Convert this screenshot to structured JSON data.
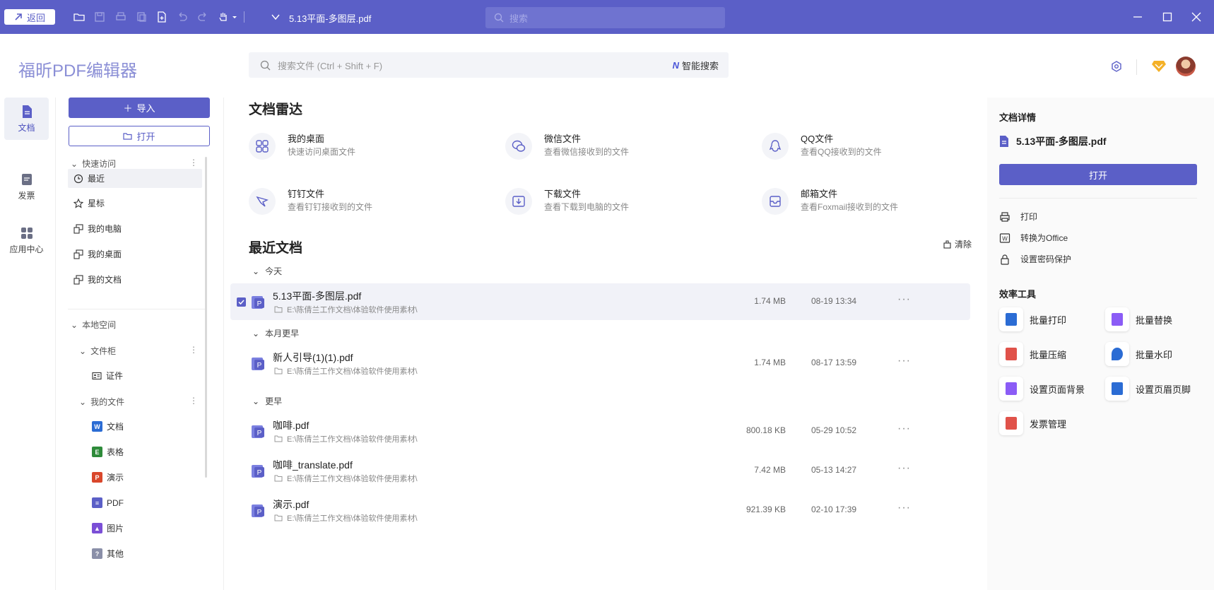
{
  "titlebar": {
    "back_label": "返回",
    "doc_title": "5.13平面-多图层.pdf",
    "search_placeholder": "搜索",
    "icons": [
      "open-folder-icon",
      "save-icon",
      "print-icon",
      "copy-icon",
      "new-file-icon",
      "undo-icon",
      "redo-icon",
      "hand-tool-icon",
      "dropdown-icon"
    ]
  },
  "header": {
    "app_title": "福昕PDF编辑器",
    "search_placeholder": "搜索文件 (Ctrl + Shift + F)",
    "ai_search_label": "智能搜索"
  },
  "leftbar": {
    "items": [
      {
        "label": "文档",
        "icon": "document-icon",
        "active": true
      },
      {
        "label": "发票",
        "icon": "invoice-icon",
        "active": false
      },
      {
        "label": "应用中心",
        "icon": "apps-icon",
        "active": false
      }
    ]
  },
  "nav": {
    "import_label": "导入",
    "open_label": "打开",
    "quick_access": {
      "label": "快速访问",
      "items": [
        {
          "label": "最近",
          "icon": "clock-icon"
        },
        {
          "label": "星标",
          "icon": "star-icon"
        },
        {
          "label": "我的电脑",
          "icon": "computer-icon"
        },
        {
          "label": "我的桌面",
          "icon": "desktop-icon"
        },
        {
          "label": "我的文档",
          "icon": "documents-icon"
        }
      ]
    },
    "local_space": {
      "label": "本地空间",
      "cabinet": {
        "label": "文件柜",
        "items": [
          {
            "label": "证件",
            "icon": "id-card-icon"
          }
        ]
      },
      "my_files": {
        "label": "我的文件",
        "items": [
          {
            "label": "文档",
            "icon": "word-icon",
            "letter": "W",
            "color": "#2b6cd4"
          },
          {
            "label": "表格",
            "icon": "excel-icon",
            "letter": "E",
            "color": "#2e8b3a"
          },
          {
            "label": "演示",
            "icon": "ppt-icon",
            "letter": "P",
            "color": "#d9472b"
          },
          {
            "label": "PDF",
            "icon": "pdf-icon",
            "letter": "≡",
            "color": "#5b5fc7"
          },
          {
            "label": "图片",
            "icon": "image-icon",
            "letter": "▲",
            "color": "#7b4fd6"
          },
          {
            "label": "其他",
            "icon": "other-icon",
            "letter": "?",
            "color": "#8a8fa8"
          }
        ]
      }
    }
  },
  "radar": {
    "title": "文档雷达",
    "items": [
      {
        "title": "我的桌面",
        "sub": "快速访问桌面文件",
        "icon": "grid-icon"
      },
      {
        "title": "微信文件",
        "sub": "查看微信接收到的文件",
        "icon": "wechat-icon"
      },
      {
        "title": "QQ文件",
        "sub": "查看QQ接收到的文件",
        "icon": "qq-icon"
      },
      {
        "title": "钉钉文件",
        "sub": "查看钉钉接收到的文件",
        "icon": "dingtalk-icon"
      },
      {
        "title": "下载文件",
        "sub": "查看下载到电脑的文件",
        "icon": "download-icon"
      },
      {
        "title": "邮箱文件",
        "sub": "查看Foxmail接收到的文件",
        "icon": "mail-icon"
      }
    ]
  },
  "recent": {
    "title": "最近文档",
    "clear_label": "清除",
    "groups": [
      {
        "label": "今天"
      },
      {
        "label": "本月更早"
      },
      {
        "label": "更早"
      }
    ],
    "files": [
      {
        "name": "5.13平面-多图层.pdf",
        "path": "E:\\陈倩兰工作文档\\体验软件使用素材\\",
        "size": "1.74 MB",
        "date": "08-19 13:34"
      },
      {
        "name": "新人引导(1)(1).pdf",
        "path": "E:\\陈倩兰工作文档\\体验软件使用素材\\",
        "size": "1.74 MB",
        "date": "08-17 13:59"
      },
      {
        "name": "咖啡.pdf",
        "path": "E:\\陈倩兰工作文档\\体验软件使用素材\\",
        "size": "800.18 KB",
        "date": "05-29 10:52"
      },
      {
        "name": "咖啡_translate.pdf",
        "path": "E:\\陈倩兰工作文档\\体验软件使用素材\\",
        "size": "7.42 MB",
        "date": "05-13 14:27"
      },
      {
        "name": "演示.pdf",
        "path": "E:\\陈倩兰工作文档\\体验软件使用素材\\",
        "size": "921.39 KB",
        "date": "02-10 17:39"
      }
    ],
    "more_label": "···"
  },
  "details": {
    "title": "文档详情",
    "file_name": "5.13平面-多图层.pdf",
    "open_label": "打开",
    "actions": [
      {
        "label": "打印",
        "icon": "print-icon"
      },
      {
        "label": "转换为Office",
        "icon": "convert-icon"
      },
      {
        "label": "设置密码保护",
        "icon": "lock-icon"
      }
    ],
    "tools_title": "效率工具",
    "tools": [
      {
        "label": "批量打印",
        "icon": "batch-print-icon",
        "color": "#2b6cd4"
      },
      {
        "label": "批量替换",
        "icon": "batch-replace-icon",
        "color": "#8b5cf6"
      },
      {
        "label": "批量压缩",
        "icon": "batch-compress-icon",
        "color": "#e0524a"
      },
      {
        "label": "批量水印",
        "icon": "batch-watermark-icon",
        "color": "#2b6cd4"
      },
      {
        "label": "设置页面背景",
        "icon": "page-background-icon",
        "color": "#8b5cf6"
      },
      {
        "label": "设置页眉页脚",
        "icon": "header-footer-icon",
        "color": "#2b6cd4"
      },
      {
        "label": "发票管理",
        "icon": "invoice-manage-icon",
        "color": "#e0524a"
      }
    ]
  },
  "colors": {
    "accent": "#5b5fc7",
    "background": "#ffffff",
    "panel": "#fafafa"
  }
}
